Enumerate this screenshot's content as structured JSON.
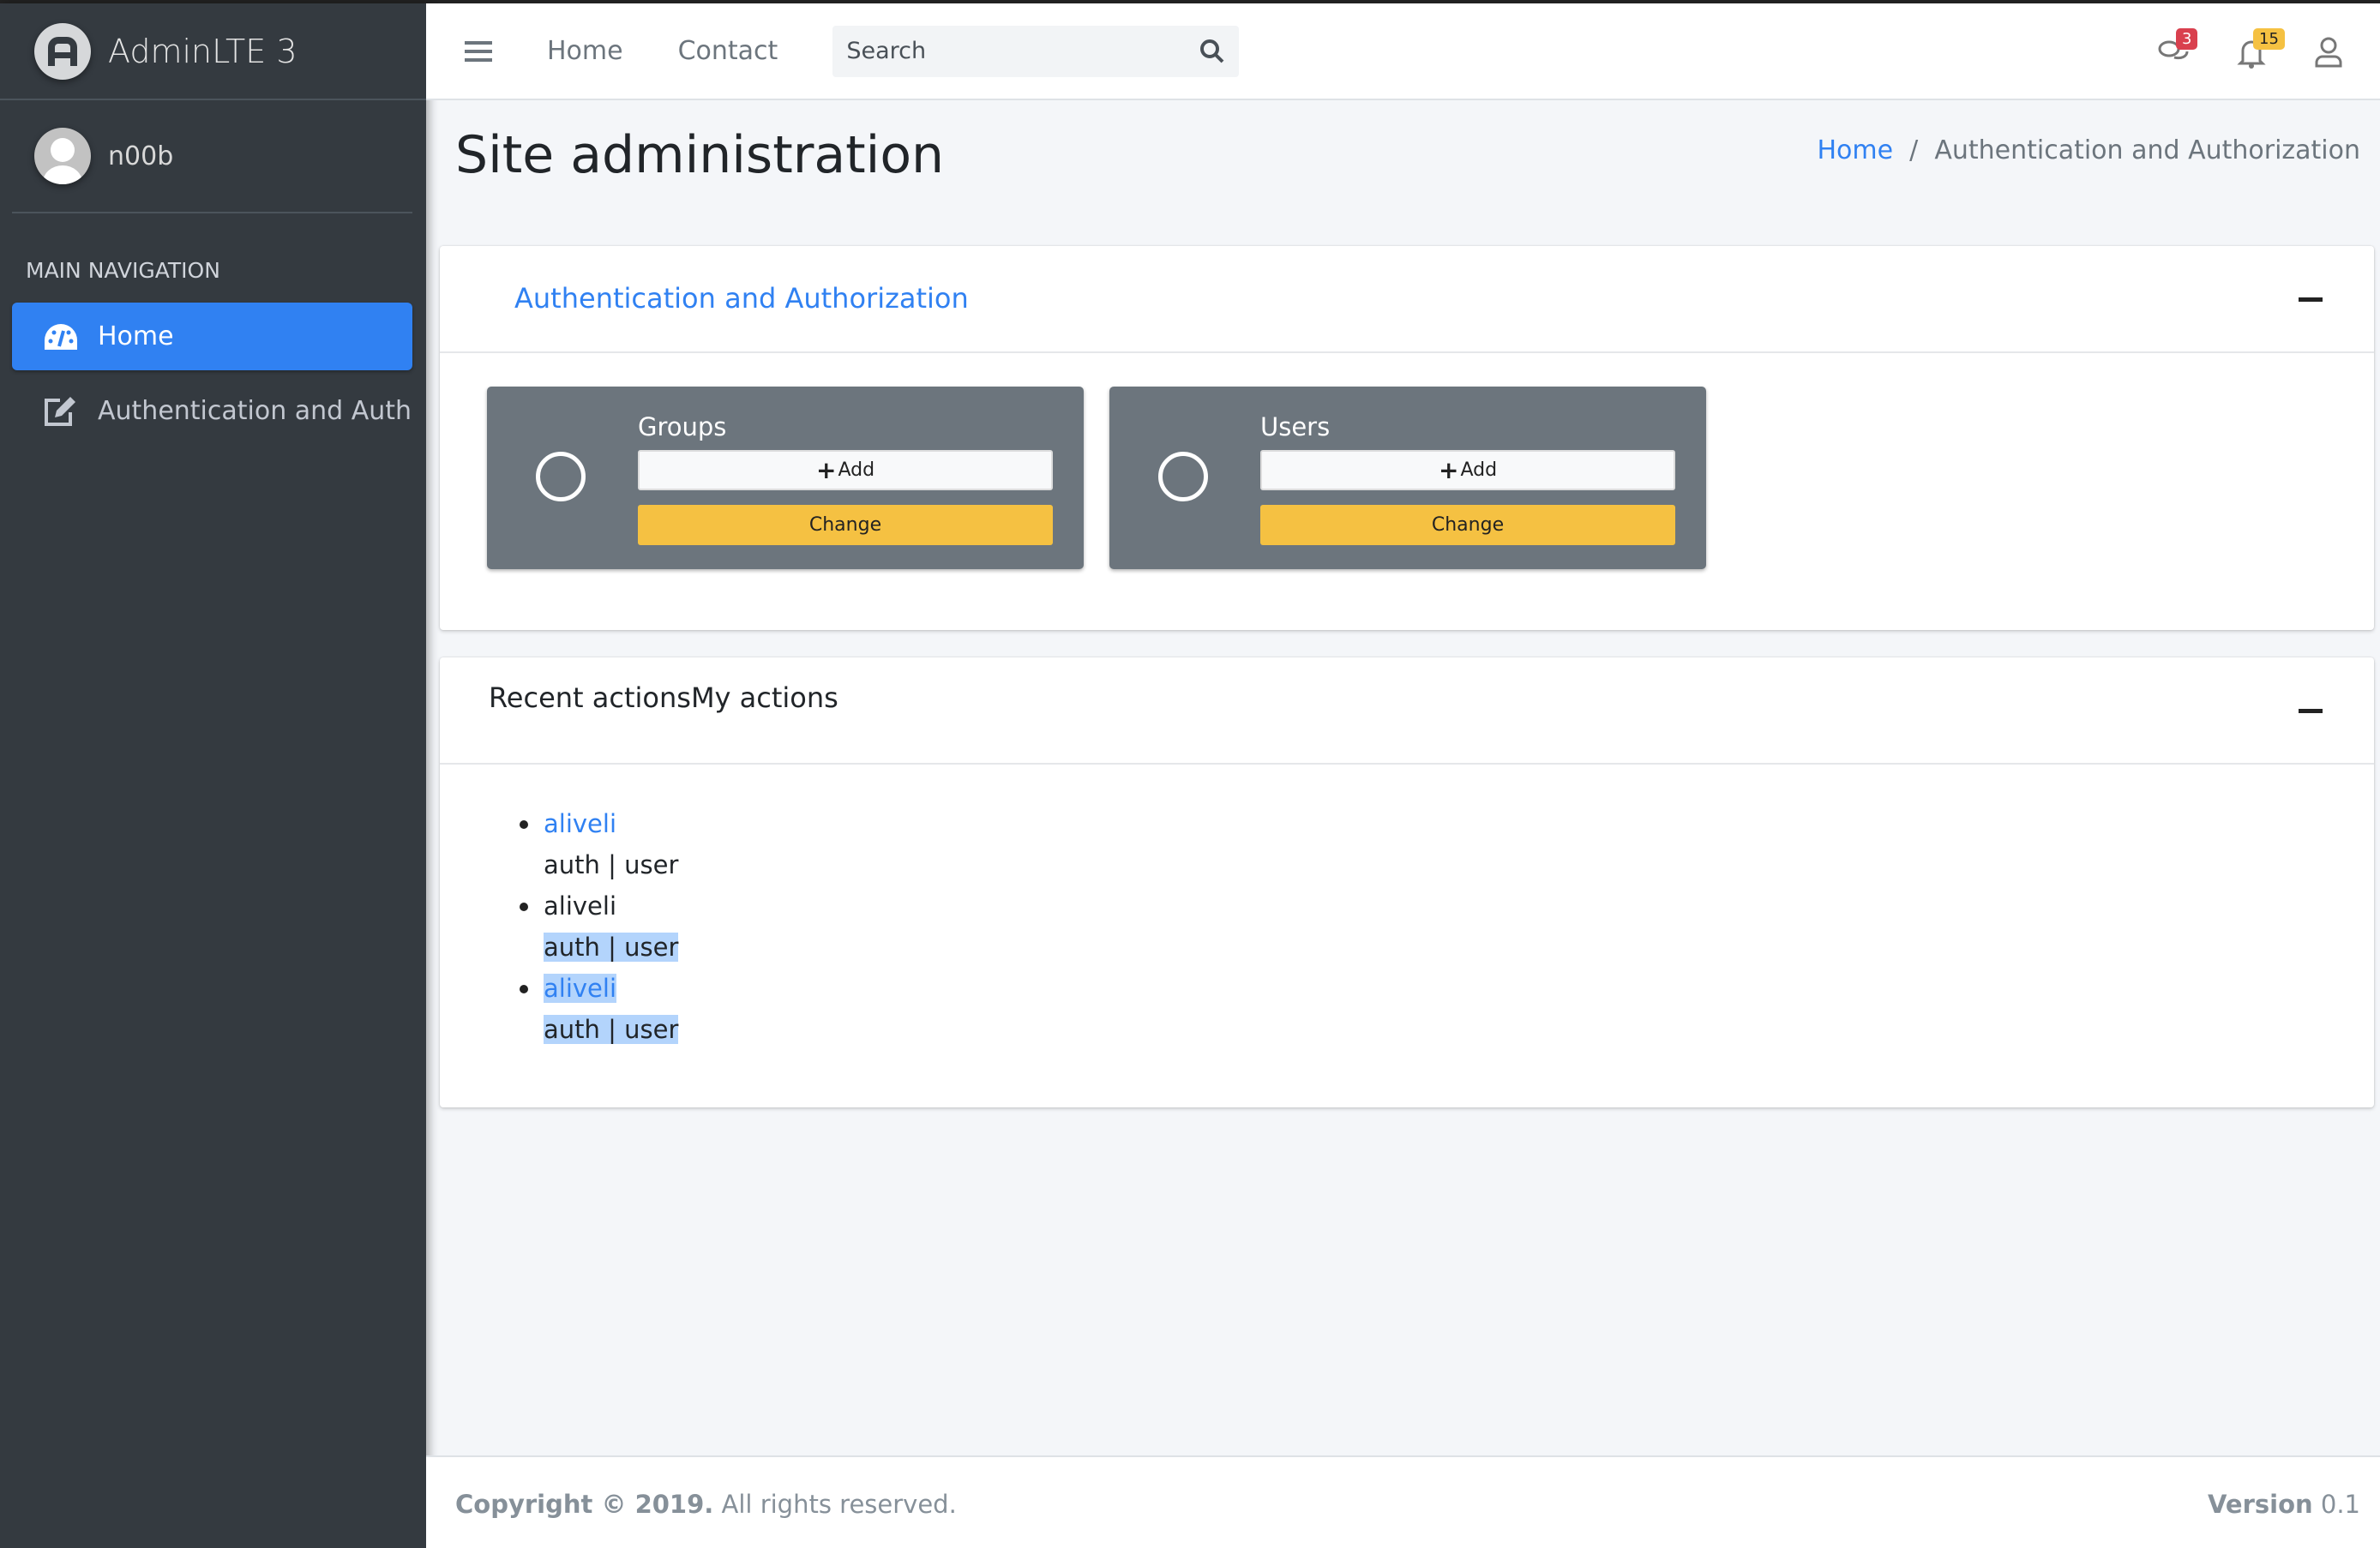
{
  "app": {
    "brand": "AdminLTE 3",
    "user": "n00b"
  },
  "sidebar": {
    "header": "MAIN NAVIGATION",
    "items": [
      {
        "label": "Home",
        "icon": "tachometer-icon",
        "active": true
      },
      {
        "label": "Authentication and Authoriz",
        "icon": "edit-icon",
        "active": false
      }
    ]
  },
  "navbar": {
    "links": [
      "Home",
      "Contact"
    ],
    "search_placeholder": "Search",
    "messages_count": "3",
    "notifications_count": "15"
  },
  "page": {
    "title": "Site administration",
    "breadcrumb": [
      "Home",
      "Authentication and Authorization"
    ]
  },
  "apps_card": {
    "title": "Authentication and Authorization",
    "models": [
      {
        "name": "Groups",
        "add": "Add",
        "change": "Change"
      },
      {
        "name": "Users",
        "add": "Add",
        "change": "Change"
      }
    ]
  },
  "recent_card": {
    "title": "Recent actionsMy actions",
    "actions": [
      {
        "object": "aliveli",
        "linked": true,
        "type": "auth | user"
      },
      {
        "object": "aliveli",
        "linked": false,
        "type": "auth | user"
      },
      {
        "object": "aliveli",
        "linked": true,
        "type": "auth | user"
      }
    ]
  },
  "footer": {
    "copyright_bold": "Copyright © 2019.",
    "copyright_rest": " All rights reserved.",
    "version_label": "Version",
    "version": " 0.1"
  },
  "colors": {
    "primary": "#3081f2",
    "sidebar": "#343a40",
    "warning": "#f5c142",
    "danger": "#d9404e",
    "box": "#6c757d"
  }
}
